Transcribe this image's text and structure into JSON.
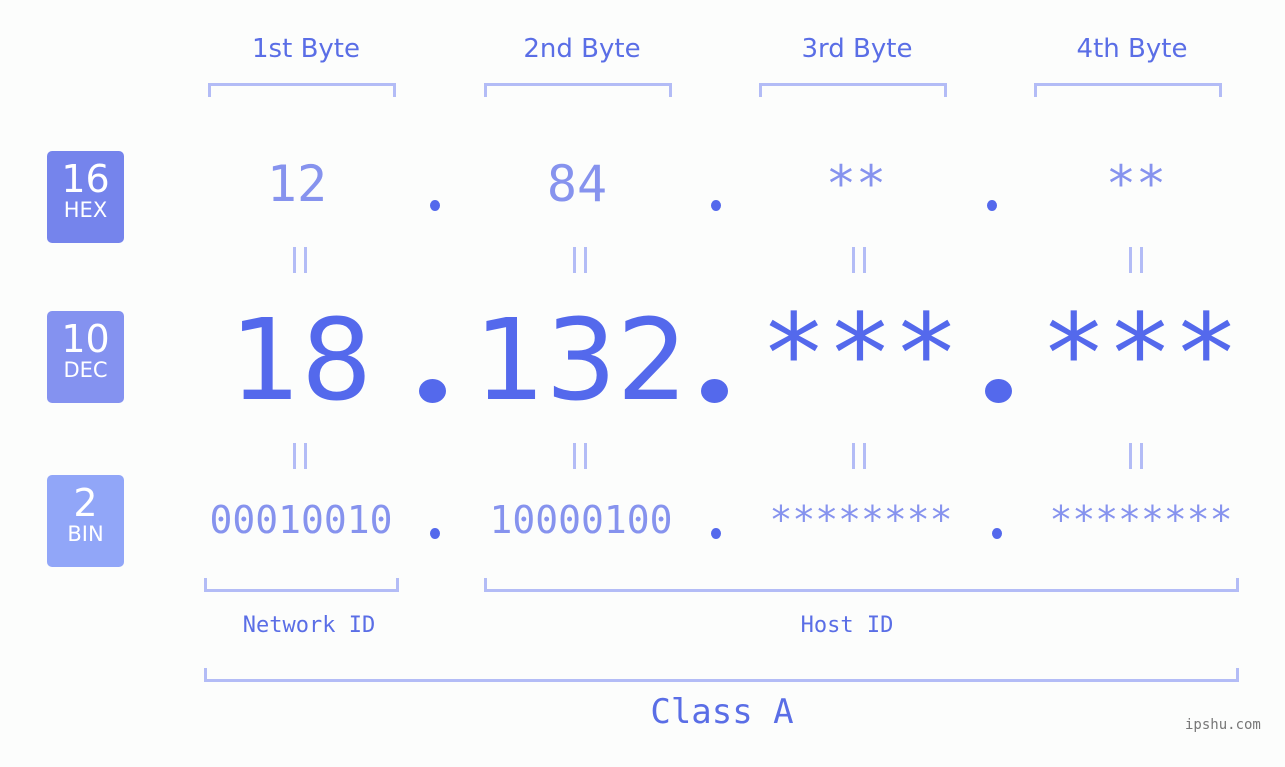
{
  "bytes": [
    {
      "header": "1st Byte",
      "hex": "12",
      "dec": "18",
      "bin": "00010010"
    },
    {
      "header": "2nd Byte",
      "hex": "84",
      "dec": "132",
      "bin": "10000100"
    },
    {
      "header": "3rd Byte",
      "hex": "**",
      "dec": "***",
      "bin": "********"
    },
    {
      "header": "4th Byte",
      "hex": "**",
      "dec": "***",
      "bin": "********"
    }
  ],
  "bases": {
    "hex": {
      "number": "16",
      "label": "HEX",
      "color": "#7584ec"
    },
    "dec": {
      "number": "10",
      "label": "DEC",
      "color": "#8492f0"
    },
    "bin": {
      "number": "2",
      "label": "BIN",
      "color": "#91a6f8"
    }
  },
  "labels": {
    "network_id": "Network ID",
    "host_id": "Host ID",
    "class": "Class A"
  },
  "credit": "ipshu.com",
  "colors": {
    "accent": "#5469ec",
    "light_accent": "#8693ee",
    "bracket": "#b3bcf6"
  }
}
